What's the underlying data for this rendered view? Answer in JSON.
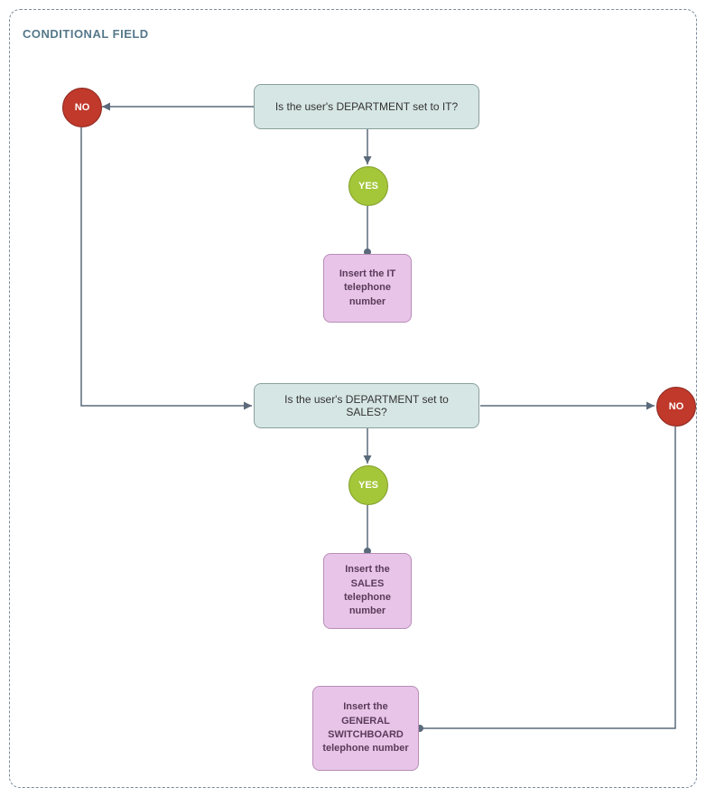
{
  "title": "CONDITIONAL FIELD",
  "decisions": {
    "d1": "Is the user's DEPARTMENT set to IT?",
    "d2": "Is the user's DEPARTMENT set to SALES?"
  },
  "labels": {
    "yes": "YES",
    "no": "NO"
  },
  "actions": {
    "a1": "Insert the IT telephone number",
    "a2": "Insert the SALES telephone number",
    "a3": "Insert the GENERAL SWITCHBOARD telephone number"
  },
  "colors": {
    "decision_bg": "#d6e6e4",
    "no_bg": "#c0392b",
    "yes_bg": "#a4c639",
    "action_bg": "#e8c5e8",
    "border_dash": "#7a8a9a",
    "title_color": "#55788a",
    "connector": "#5a6a7a"
  }
}
